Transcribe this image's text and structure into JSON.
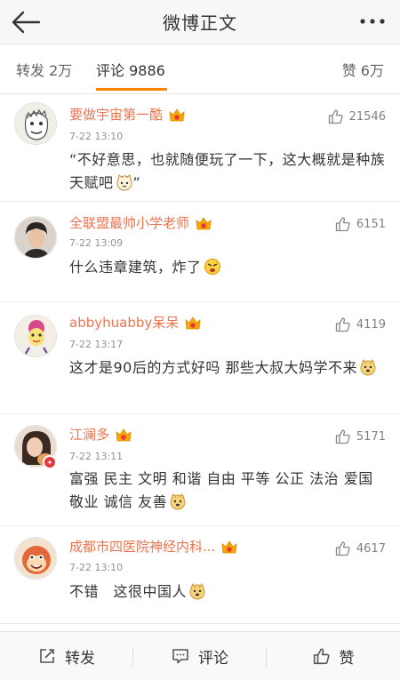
{
  "header": {
    "title": "微博正文"
  },
  "tabs": {
    "repost": "转发 2万",
    "comments": "评论 9886",
    "likes": "赞 6万"
  },
  "comments": [
    {
      "user": "要做宇宙第一酷",
      "time": "7-22 13:10",
      "text": "“不好意思，也就随便玩了一下，这大概就是种族天赋吧",
      "text_end": "”",
      "likes": "21546"
    },
    {
      "user": "全联盟最帅小学老师",
      "time": "7-22 13:09",
      "text": "什么违章建筑，炸了",
      "text_end": "",
      "likes": "6151"
    },
    {
      "user": "abbyhuabby呆呆",
      "time": "7-22 13:17",
      "text": "这才是90后的方式好吗 那些大叔大妈学不来",
      "text_end": "",
      "likes": "4119"
    },
    {
      "user": "江澜多",
      "time": "7-22 13:11",
      "text": "富强 民主 文明 和谐 自由 平等 公正 法治 爱国 敬业 诚信 友善",
      "text_end": "",
      "likes": "5171"
    },
    {
      "user": "成都市四医院神经内科...",
      "time": "7-22 13:10",
      "text": "不错　这很中国人",
      "text_end": "",
      "likes": "4617"
    }
  ],
  "bottombar": {
    "repost": "转发",
    "comment": "评论",
    "like": "赞"
  },
  "colors": {
    "accent": "#ff8200",
    "username": "#eb7350"
  }
}
